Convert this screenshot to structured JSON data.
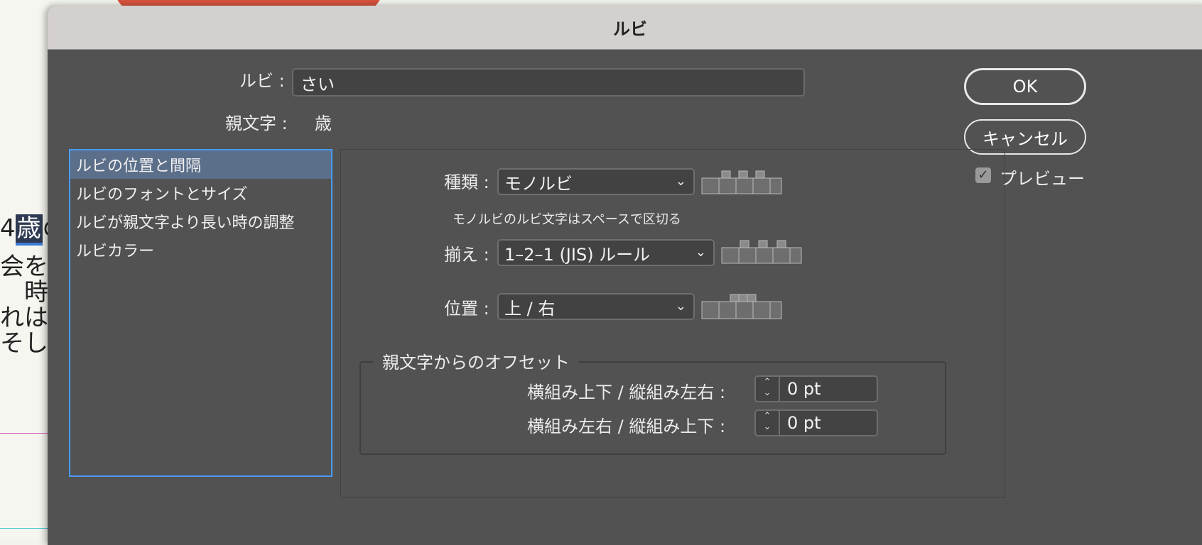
{
  "background_doc": {
    "lines": [
      {
        "pre": "4",
        "highlight": "歳",
        "post": "の"
      },
      {
        "pre": "会を描",
        "highlight": "",
        "post": ""
      },
      {
        "pre": "　時々",
        "highlight": "",
        "post": ""
      },
      {
        "pre": "れはシ",
        "highlight": "",
        "post": ""
      },
      {
        "pre": "そして",
        "highlight": "",
        "post": ""
      }
    ]
  },
  "dialog": {
    "title": "ルビ",
    "ruby_label": "ルビ :",
    "ruby_value": "さい",
    "base_text_label": "親文字 :",
    "base_text_value": "歳",
    "ok_label": "OK",
    "cancel_label": "キャンセル",
    "preview_label": "プレビュー",
    "preview_checked": true
  },
  "sidebar": {
    "items": [
      {
        "label": "ルビの位置と間隔",
        "selected": true
      },
      {
        "label": "ルビのフォントとサイズ",
        "selected": false
      },
      {
        "label": "ルビが親文字より長い時の調整",
        "selected": false
      },
      {
        "label": "ルビカラー",
        "selected": false
      }
    ]
  },
  "panel": {
    "type_label": "種類 :",
    "type_value": "モノルビ",
    "type_hint": "モノルビのルビ文字はスペースで区切る",
    "align_label": "揃え :",
    "align_value": "1–2–1 (JIS) ルール",
    "position_label": "位置 :",
    "position_value": "上 / 右",
    "offset_legend": "親文字からのオフセット",
    "offset_rows": [
      {
        "label": "横組み上下 / 縦組み左右 :",
        "value": "0 pt"
      },
      {
        "label": "横組み左右 / 縦組み上下 :",
        "value": "0 pt"
      }
    ]
  },
  "colors": {
    "dialog_bg": "#525252",
    "titlebar_bg": "#d4d0ce",
    "selection": "#5b6f8a",
    "focus": "#4a9bf0"
  }
}
